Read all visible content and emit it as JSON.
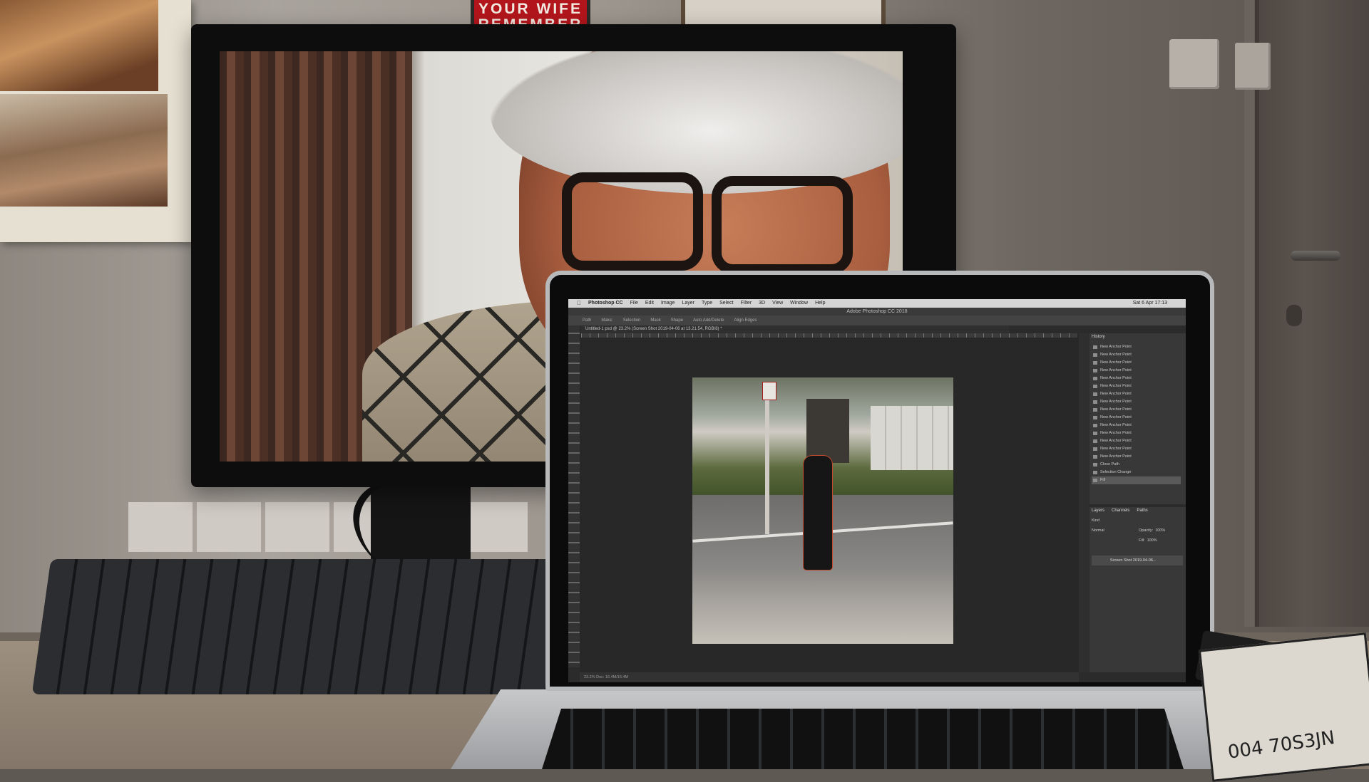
{
  "poster": {
    "line1": "YOUR WIFE",
    "line2": "REMEMBER"
  },
  "tape": {
    "label": "004 70S3JN"
  },
  "photoshop": {
    "menubar": {
      "app": "Photoshop CC",
      "items": [
        "File",
        "Edit",
        "Image",
        "Layer",
        "Type",
        "Select",
        "Filter",
        "3D",
        "View",
        "Window",
        "Help"
      ],
      "clock": "Sat 6 Apr 17:13"
    },
    "window_title": "Adobe Photoshop CC 2018",
    "options": [
      "Path",
      "Make:",
      "Selection",
      "Mask",
      "Shape",
      "Auto Add/Delete",
      "Align Edges"
    ],
    "document_tab": "Untitled-1 psd @ 23.2% (Screen Shot 2019-04-06 at 13.21.54, RGB/8) *",
    "history": {
      "tab": "History",
      "items": [
        "New Anchor Point",
        "New Anchor Point",
        "New Anchor Point",
        "New Anchor Point",
        "New Anchor Point",
        "New Anchor Point",
        "New Anchor Point",
        "New Anchor Point",
        "New Anchor Point",
        "New Anchor Point",
        "New Anchor Point",
        "New Anchor Point",
        "New Anchor Point",
        "New Anchor Point",
        "New Anchor Point",
        "Close Path",
        "Selection Change",
        "Fill"
      ]
    },
    "layers": {
      "tabs": [
        "Layers",
        "Channels",
        "Paths"
      ],
      "kind": "Kind",
      "blend": "Normal",
      "opacity_label": "Opacity:",
      "opacity": "100%",
      "fill_label": "Fill:",
      "fill": "100%",
      "layer_name": "Screen Shot 2019-04-06..."
    },
    "status": "23.2%   Doc: 16.4M/16.4M"
  }
}
